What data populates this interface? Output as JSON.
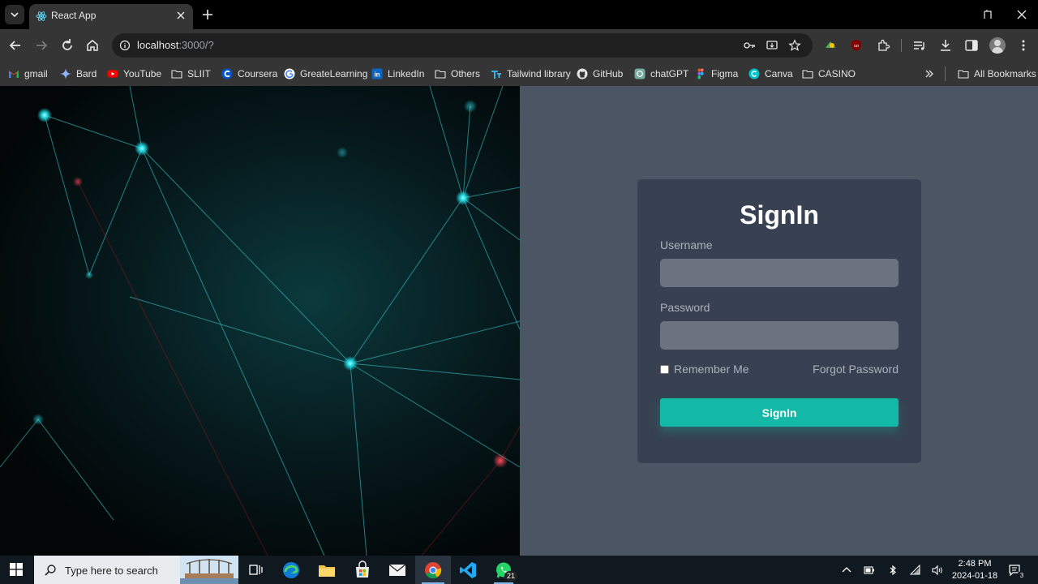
{
  "browser": {
    "tab_title": "React App",
    "url_host": "localhost",
    "url_rest": ":3000/?",
    "bookmarks": [
      {
        "label": "gmail",
        "icon": "gmail-icon"
      },
      {
        "label": "Bard",
        "icon": "bard-icon"
      },
      {
        "label": "YouTube",
        "icon": "youtube-icon"
      },
      {
        "label": "SLIIT",
        "icon": "folder-icon"
      },
      {
        "label": "Coursera",
        "icon": "coursera-icon"
      },
      {
        "label": "GreateLearning",
        "icon": "google-icon"
      },
      {
        "label": "LinkedIn",
        "icon": "linkedin-icon"
      },
      {
        "label": "Others",
        "icon": "folder-icon"
      },
      {
        "label": "Tailwind library",
        "icon": "tailwind-icon"
      },
      {
        "label": "GitHub",
        "icon": "github-icon"
      },
      {
        "label": "chatGPT",
        "icon": "chatgpt-icon"
      },
      {
        "label": "Figma",
        "icon": "figma-icon"
      },
      {
        "label": "Canva",
        "icon": "canva-icon"
      },
      {
        "label": "CASINO",
        "icon": "folder-icon"
      }
    ],
    "all_bookmarks": "All Bookmarks"
  },
  "signin": {
    "title": "SignIn",
    "username_label": "Username",
    "username_value": "",
    "password_label": "Password",
    "password_value": "",
    "remember_label": "Remember Me",
    "remember_checked": false,
    "forgot_label": "Forgot Password",
    "submit_label": "SignIn"
  },
  "taskbar": {
    "search_placeholder": "Type here to search",
    "time": "2:48 PM",
    "date": "2024-01-18",
    "whatsapp_badge": "21",
    "notification_count": "3"
  },
  "colors": {
    "accent": "#14b8a6",
    "card": "#374151",
    "panel": "#4b5563",
    "input": "#6b7280"
  }
}
